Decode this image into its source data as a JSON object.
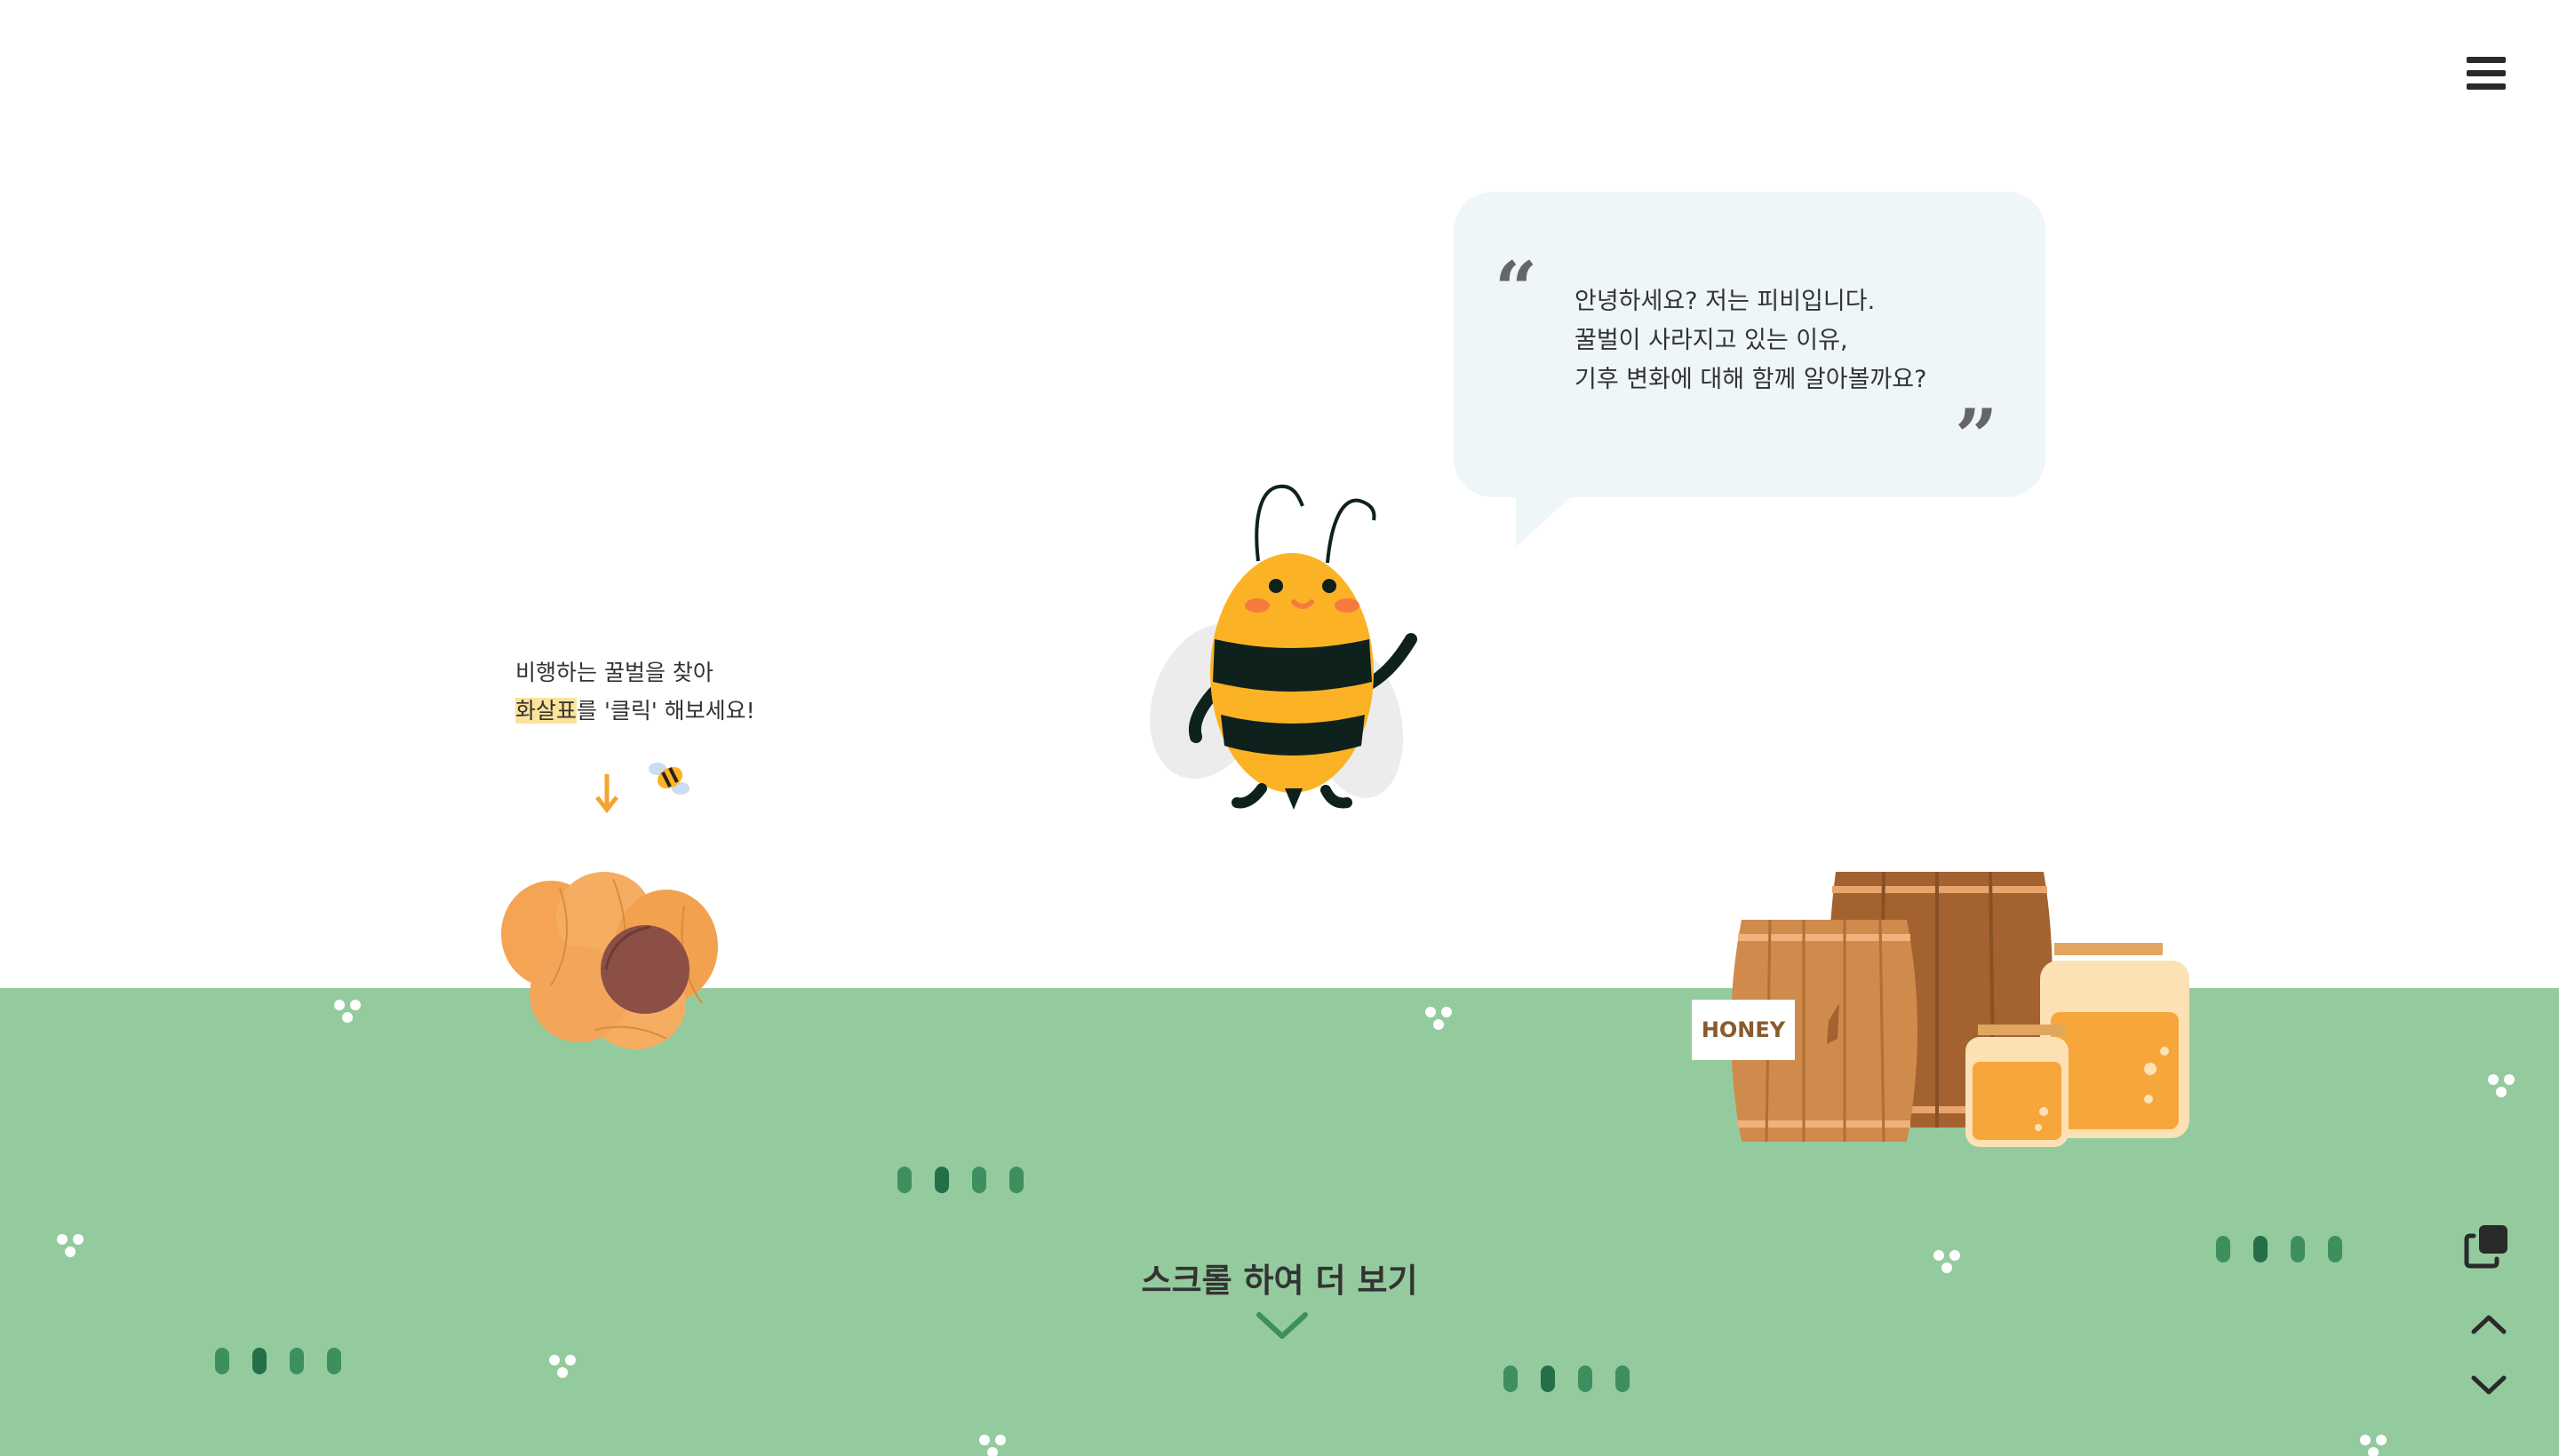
{
  "menu": {
    "icon": "hamburger-menu-icon"
  },
  "speech_bubble": {
    "lines": [
      "안녕하세요? 저는 피비입니다.",
      "꿀벌이 사라지고 있는 이유,",
      "기후 변화에 대해 함께 알아볼까요?"
    ],
    "open_quote": "“",
    "close_quote": "”"
  },
  "hint": {
    "line1": "비행하는 꿀벌을 찾아",
    "line2_highlight": "화살표",
    "line2_rest": "를 '클릭' 해보세요!"
  },
  "barrel": {
    "label": "HONEY"
  },
  "scroll": {
    "label": "스크롤 하여 더 보기"
  },
  "side_controls": {
    "copy_icon": "copy-icon",
    "up_icon": "chevron-up-icon",
    "down_icon": "chevron-down-icon"
  },
  "colors": {
    "ground": "#94cb9e",
    "bee_yellow": "#fbb325",
    "bee_stripe": "#0f211c",
    "bubble_bg": "#eef6f9",
    "highlight": "#fce39a",
    "arrow": "#f6a431"
  }
}
